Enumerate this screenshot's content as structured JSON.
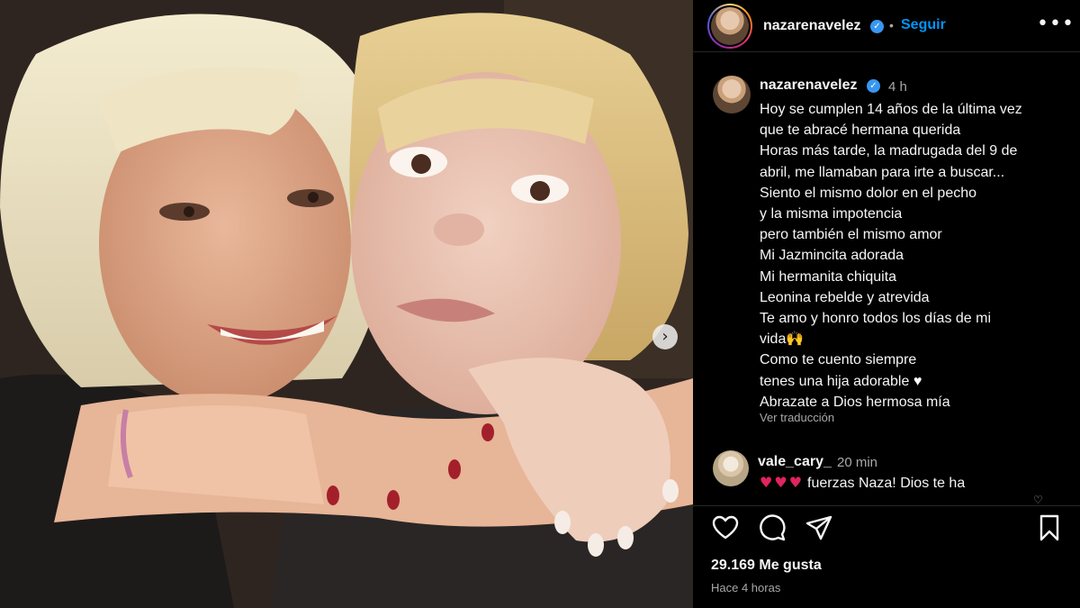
{
  "post": {
    "username": "nazarenavelez",
    "follow_label": "Seguir",
    "separator": "•",
    "more_label": "•••",
    "verified_glyph": "✓"
  },
  "caption": {
    "username": "nazarenavelez",
    "time": "4 h",
    "lines": [
      "Hoy se cumplen 14 años de la última vez",
      "que te abracé hermana querida",
      "Horas más tarde, la madrugada del 9 de",
      "abril, me llamaban para irte a buscar...",
      "Siento el mismo dolor en el pecho",
      "y la misma impotencia",
      "pero también el mismo amor",
      "Mi Jazmincita adorada",
      "Mi hermanita chiquita",
      "Leonina rebelde y atrevida",
      "Te amo y honro todos los días de mi",
      "vida🙌",
      "Como te cuento siempre",
      "tenes una hija adorable",
      "Abrazate a Dios hermosa mía"
    ],
    "heart_glyph": "♥",
    "translate_label": "Ver traducción"
  },
  "comment": {
    "username": "vale_cary_",
    "time": "20 min",
    "hearts": "♥♥♥",
    "text": "fuerzas Naza! Dios te ha",
    "like_glyph": "♡"
  },
  "footer": {
    "likes": "29.169 Me gusta",
    "ago": "Hace 4 horas"
  },
  "icons": {
    "like": "heart-icon",
    "comment": "comment-icon",
    "share": "share-icon",
    "save": "bookmark-icon",
    "next": "chevron-right-icon"
  },
  "photo": {
    "next_glyph": "›"
  },
  "colors": {
    "background": "#000000",
    "accent": "#0095f6",
    "verified": "#3897f0",
    "muted": "#a8a8a8",
    "heart_red": "#e0245e"
  }
}
